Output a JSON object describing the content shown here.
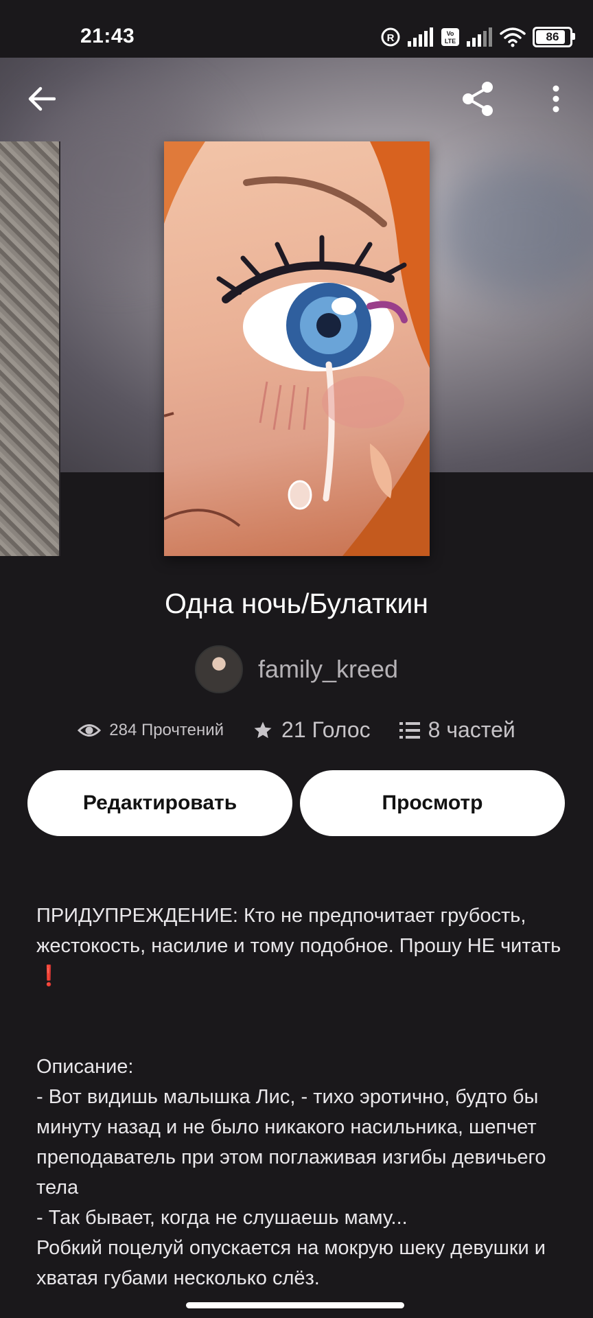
{
  "status_bar": {
    "time": "21:43",
    "battery": "86",
    "icons": [
      "registered-icon",
      "signal-icon",
      "volte-icon",
      "signal-icon",
      "wifi-icon",
      "battery-icon"
    ]
  },
  "header": {
    "back_icon": "arrow-left-icon",
    "share_icon": "share-icon",
    "more_icon": "more-vertical-icon"
  },
  "story": {
    "title": "Одна ночь/Булаткин",
    "author": "family_kreed",
    "stats": {
      "reads": "284 Прочтений",
      "votes": "21 Голос",
      "parts": "8 частей"
    }
  },
  "actions": {
    "edit_label": "Редактировать",
    "view_label": "Просмотр"
  },
  "description": {
    "warning_line1": "ПРИДУПРЕЖДЕНИЕ: Кто не предпочитает грубость, жестокость, насилие и тому подобное. Прошу НЕ читать",
    "warning_mark": "❗",
    "heading": "Описание:",
    "line1": "- Вот видишь малышка Лис, - тихо эротично, будто бы минуту назад и не было никакого насильника, шепчет преподаватель при этом поглаживая изгибы девичьего тела",
    "line2": "- Так бывает, когда не слушаешь маму...",
    "line3": "Робкий поцелуй опускается на мокрую шеку девушки и хватая губами несколько слёз."
  },
  "colors": {
    "background": "#1a181b",
    "button_bg": "#ffffff",
    "text_muted": "#b5b2b6",
    "warning_red": "#e53935"
  }
}
